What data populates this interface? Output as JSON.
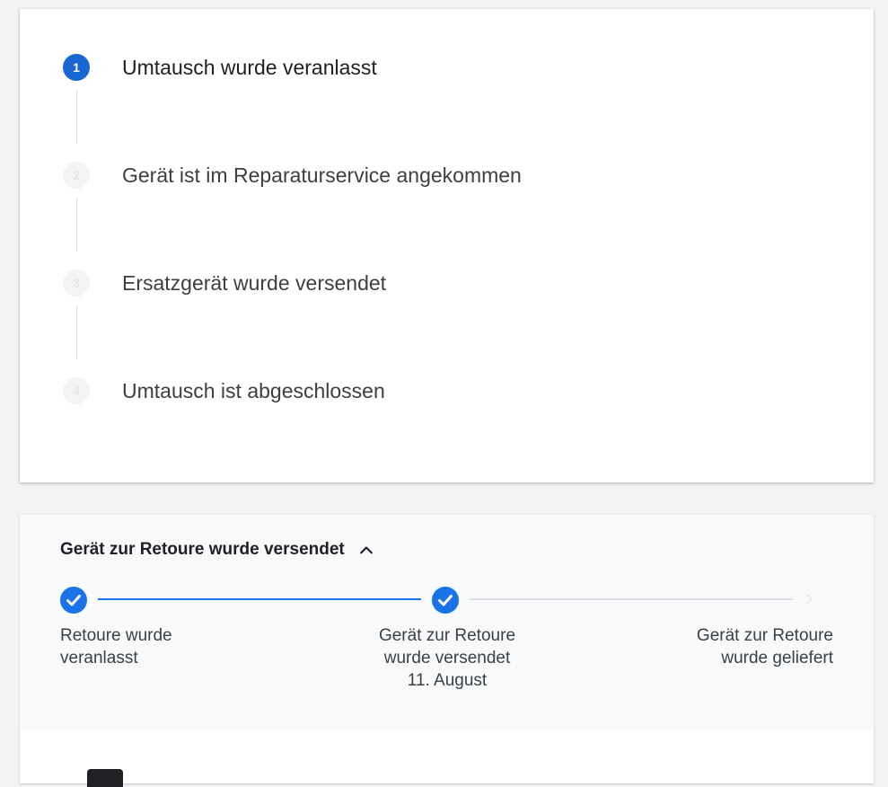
{
  "exchange_steps": [
    {
      "number": "1",
      "label": "Umtausch wurde veranlasst",
      "state": "active"
    },
    {
      "number": "2",
      "label": "Gerät ist im Reparaturservice angekommen",
      "state": "inactive"
    },
    {
      "number": "3",
      "label": "Ersatzgerät wurde versendet",
      "state": "inactive"
    },
    {
      "number": "4",
      "label": "Umtausch ist abgeschlossen",
      "state": "inactive"
    }
  ],
  "return_tracking": {
    "title": "Gerät zur Retoure wurde versendet",
    "steps": [
      {
        "line1": "Retoure wurde",
        "line2": "veranlasst",
        "line3": "",
        "done": true
      },
      {
        "line1": "Gerät zur Retoure",
        "line2": "wurde versendet",
        "line3": "11. August",
        "done": true
      },
      {
        "line1": "Gerät zur Retoure",
        "line2": "wurde geliefert",
        "line3": "",
        "done": false
      }
    ]
  },
  "colors": {
    "accent": "#1967d2",
    "progress_done": "#1a73e8",
    "progress_pending": "#dadce0"
  },
  "icons": {
    "collapse": "chevron-up-icon",
    "done": "checkmark-icon"
  }
}
